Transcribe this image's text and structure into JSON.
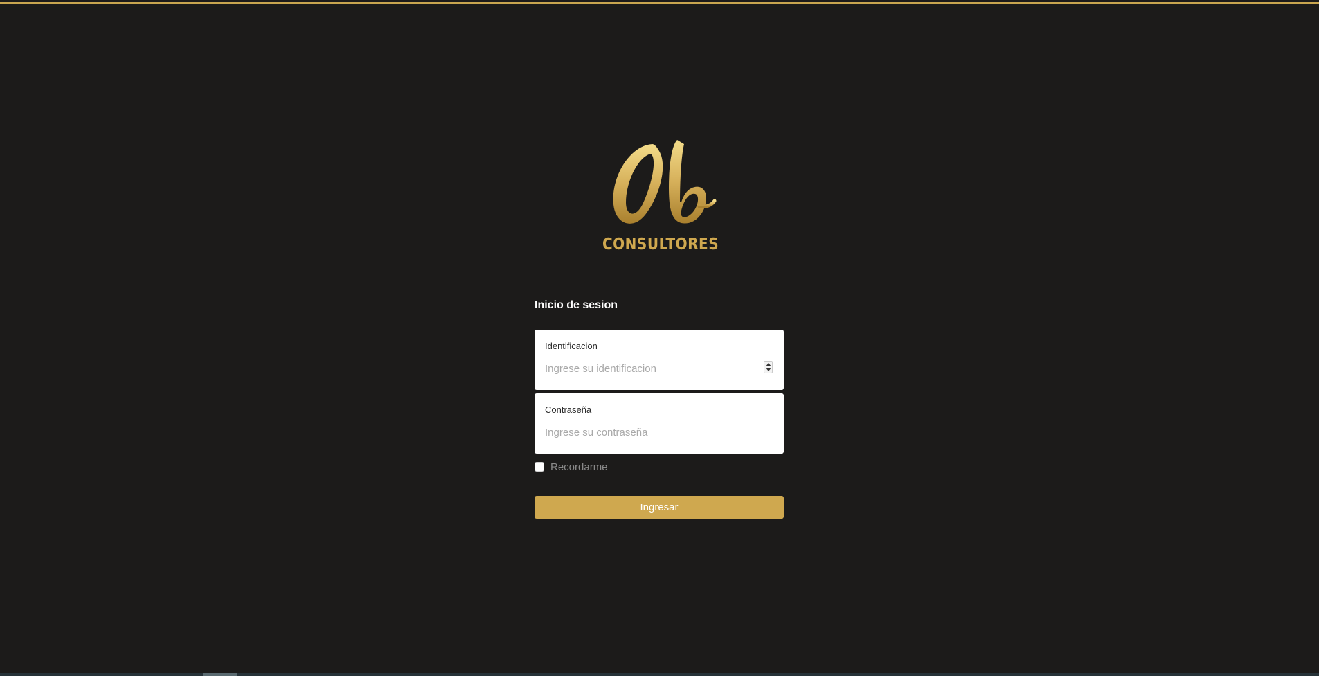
{
  "brand": {
    "logo_word": "CONSULTORES",
    "accent_color": "#cfa84f",
    "background_color": "#1c1b1a"
  },
  "login": {
    "title": "Inicio de sesion",
    "id_field": {
      "label": "Identificacion",
      "placeholder": "Ingrese su identificacion",
      "value": ""
    },
    "password_field": {
      "label": "Contraseña",
      "placeholder": "Ingrese su contraseña",
      "value": ""
    },
    "remember_label": "Recordarme",
    "remember_checked": false,
    "submit_label": "Ingresar"
  }
}
